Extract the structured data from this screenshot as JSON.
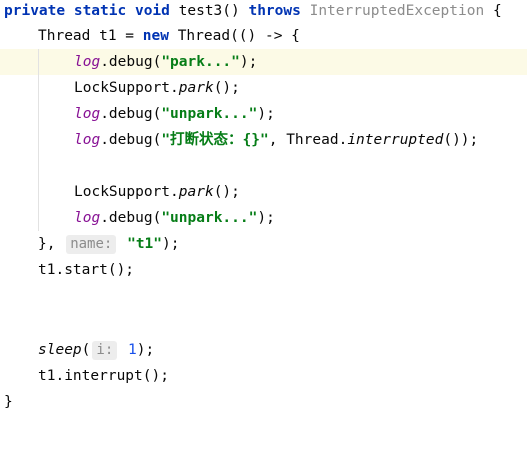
{
  "editor": {
    "lines": {
      "l1": {
        "private": "private",
        "static": "static",
        "void": "void",
        "method": "test3()",
        "throws": "throws",
        "exception": "InterruptedException",
        "brace": "{"
      },
      "l2": {
        "decl": "Thread t1 = ",
        "new": "new",
        "ctor": " Thread(() -> {"
      },
      "l3": {
        "log": "log",
        "call": ".debug(",
        "str": "\"park...\"",
        "end": ");"
      },
      "l4": {
        "cls": "LockSupport.",
        "method": "park",
        "end": "();"
      },
      "l5": {
        "log": "log",
        "call": ".debug(",
        "str": "\"unpark...\"",
        "end": ");"
      },
      "l6": {
        "log": "log",
        "call": ".debug(",
        "str": "\"打断状态：{}\"",
        "mid": ", Thread.",
        "method": "interrupted",
        "end": "());"
      },
      "l8": {
        "cls": "LockSupport.",
        "method": "park",
        "end": "();"
      },
      "l9": {
        "log": "log",
        "call": ".debug(",
        "str": "\"unpark...\"",
        "end": ");"
      },
      "l10": {
        "close": "}, ",
        "hint": "name:",
        "str": "\"t1\"",
        "end": ");"
      },
      "l11": {
        "code": "t1.start();"
      },
      "l14": {
        "method": "sleep",
        "open": "(",
        "hint": "i:",
        "num": "1",
        "end": ");"
      },
      "l15": {
        "code": "t1.interrupt();"
      },
      "l16": {
        "code": "}"
      }
    }
  }
}
